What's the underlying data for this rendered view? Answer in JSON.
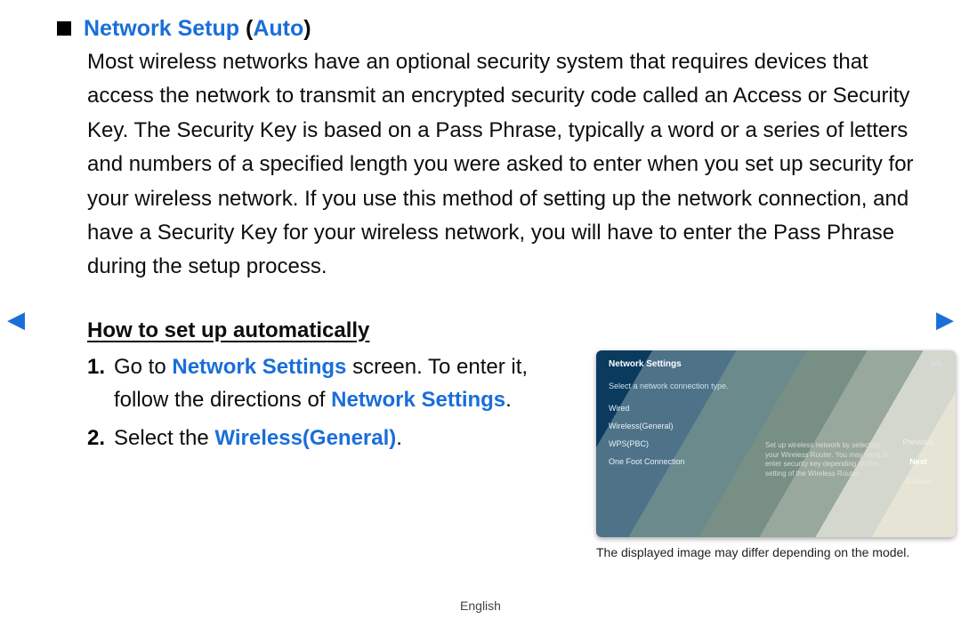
{
  "section": {
    "title_main": "Network Setup ",
    "title_paren_open": "(",
    "title_auto": "Auto",
    "title_paren_close": ")",
    "paragraph": "Most wireless networks have an optional security system that requires devices that access the network to transmit an encrypted security code called an Access or Security Key. The Security Key is based on a Pass Phrase, typically a word or a series of letters and numbers of a specified length you were asked to enter when you set up security for your wireless network. If you use this method of setting up the network connection, and have a Security Key for your wireless network, you will have to enter the Pass Phrase during the setup process."
  },
  "sub_heading": "How to set up automatically",
  "steps": [
    {
      "pre1": "Go to ",
      "hl1": "Network Settings",
      "pre2": " screen. To enter it, follow the directions of ",
      "hl2": "Network Settings",
      "post": "."
    },
    {
      "pre1": "Select the ",
      "hl1": "Wireless(General)",
      "post": "."
    }
  ],
  "tv": {
    "title": "Network Settings",
    "counter": "2/6",
    "subtitle": "Select a network connection type.",
    "options": [
      "Wired",
      "Wireless(General)",
      "WPS(PBC)",
      "One Foot Connection"
    ],
    "help": "Set up wireless network by selecting your Wireless Router. You may need to enter security key depending on the setting of the Wireless Router.",
    "right": {
      "previous": "Previous",
      "next": "Next",
      "cancel": "Cancel"
    }
  },
  "caption": "The displayed image may differ depending on the model.",
  "footer_lang": "English",
  "nav": {
    "left": "◀",
    "right": "▶"
  }
}
